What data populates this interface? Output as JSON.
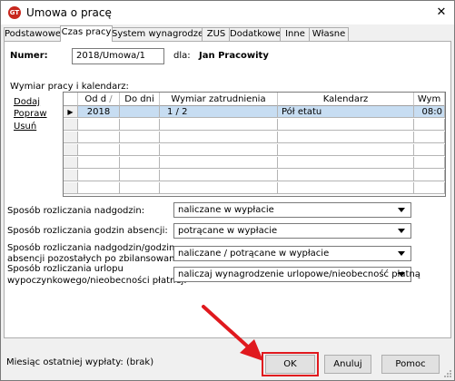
{
  "window": {
    "title": "Umowa o pracę",
    "app_icon_text": "GT",
    "close_glyph": "✕"
  },
  "tabs": [
    {
      "label": "Podstawowe",
      "active": false
    },
    {
      "label": "Czas pracy",
      "active": true
    },
    {
      "label": "System wynagrodzeń",
      "active": false
    },
    {
      "label": "ZUS",
      "active": false
    },
    {
      "label": "Dodatkowe",
      "active": false
    },
    {
      "label": "Inne",
      "active": false
    },
    {
      "label": "Własne",
      "active": false
    }
  ],
  "header": {
    "numer_label": "Numer:",
    "numer_value": "2018/Umowa/1",
    "dla_label": "dla:",
    "employee": "Jan Pracowity"
  },
  "section": {
    "label": "Wymiar pracy i kalendarz:"
  },
  "actions": {
    "add": "Dodaj",
    "edit": "Popraw",
    "delete": "Usuń"
  },
  "grid": {
    "columns": [
      "Od d",
      "Do dni",
      "Wymiar zatrudnienia",
      "Kalendarz",
      "Wym"
    ],
    "sort_glyph": "/",
    "rows": [
      {
        "od": "2018",
        "do": "",
        "wymiar": "1 / 2",
        "kalendarz": "Pół etatu",
        "wym": "08:0",
        "selected": true,
        "indicator": "▶"
      }
    ],
    "empty_rows": 6
  },
  "settings": [
    {
      "label_lines": [
        "Sposób rozliczania nadgodzin:"
      ],
      "value": "naliczane w wypłacie"
    },
    {
      "label_lines": [
        "Sposób rozliczania godzin absencji:"
      ],
      "value": "potrącane w wypłacie"
    },
    {
      "label_lines": [
        "Sposób rozliczania nadgodzin/godzin",
        "absencji pozostałych po zbilansowaniu:"
      ],
      "value": "naliczane / potrącane w wypłacie"
    },
    {
      "label_lines": [
        "Sposób rozliczania urlopu",
        "wypoczynkowego/nieobecności płatnej:"
      ],
      "value": "naliczaj wynagrodzenie urlopowe/nieobecność płatną"
    }
  ],
  "footer": {
    "last_payout": "Miesiąc ostatniej wypłaty: (brak)"
  },
  "buttons": {
    "ok": "OK",
    "cancel": "Anuluj",
    "help": "Pomoc"
  },
  "colors": {
    "selection": "#c7ddf2",
    "highlight": "#e0191e",
    "app_icon": "#c8281e"
  }
}
